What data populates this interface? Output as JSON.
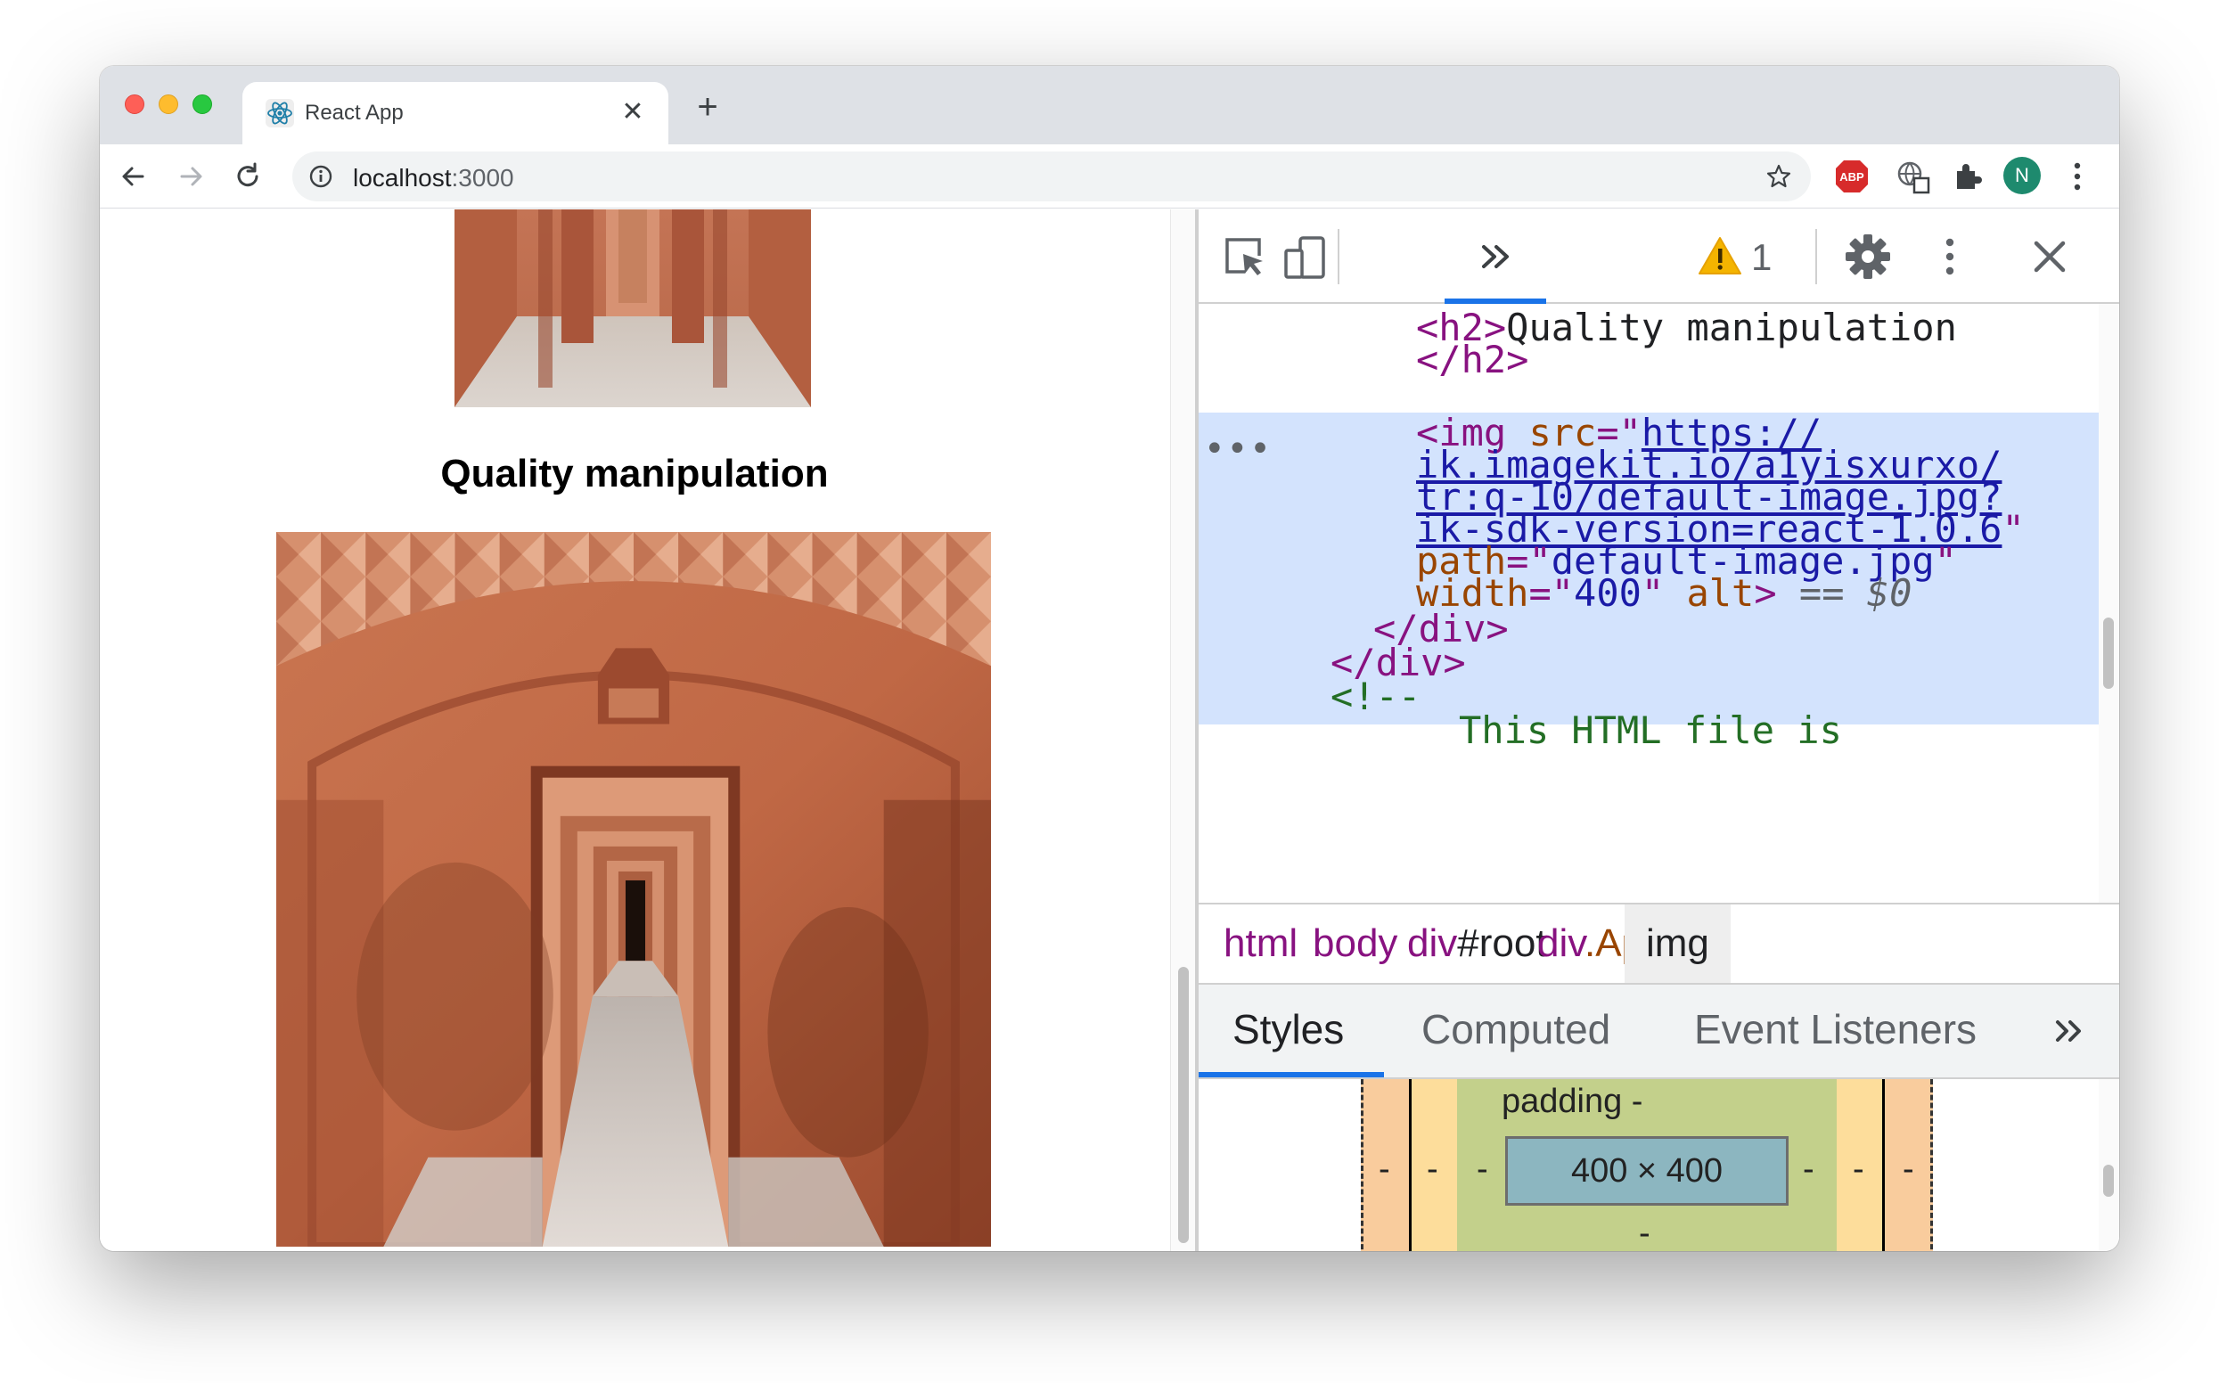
{
  "browser": {
    "tab_title": "React App",
    "tab_close": "✕",
    "new_tab": "+",
    "url_host": "localhost",
    "url_port": ":3000",
    "profile_initial": "N"
  },
  "page": {
    "heading": "Quality manipulation"
  },
  "devtools": {
    "warning_count": "1",
    "dom_ellipsis": "•••",
    "dom_lines": {
      "h2_open": "<h2>",
      "h2_text": "Quality manipulation",
      "h2_close": "</h2>",
      "img_open": "<img",
      "src_attr": "src",
      "eq": "=",
      "quote": "\"",
      "src_line1": "https://",
      "src_line2": "ik.imagekit.io/a1yisxurxo/",
      "src_line3": "tr:q-10/default-image.jpg?",
      "src_line4": "ik-sdk-version=react-1.0.6",
      "path_attr": "path",
      "path_val": "default-image.jpg",
      "width_attr": "width",
      "width_val": "400",
      "alt_attr": "alt",
      "gt": ">",
      "eq_dollar": " == ",
      "dollar0": "$0",
      "div_close1": "</div>",
      "div_close2": "</div>",
      "comment_open": "<!--",
      "comment_partial": "This HTML file is"
    },
    "breadcrumbs": [
      {
        "label": "html"
      },
      {
        "label": "body"
      },
      {
        "label_tag": "div",
        "label_id": "#root"
      },
      {
        "label_tag": "div",
        "label_cls": ".App"
      },
      {
        "label": "img"
      }
    ],
    "subtabs": [
      "Styles",
      "Computed",
      "Event Listeners"
    ],
    "box_model": {
      "padding_label": "padding -",
      "content_size": "400 × 400",
      "dash": "-"
    }
  },
  "colors": {
    "devtools_selection": "#d3e3fd",
    "tag": "#881280",
    "attr_name": "#994500",
    "attr_value": "#1a1aa6",
    "accent": "#1a73e8"
  },
  "icons": [
    "react-favicon",
    "back-icon",
    "forward-icon",
    "reload-icon",
    "info-icon",
    "star-icon",
    "adblock-icon",
    "translate-icon",
    "extensions-icon",
    "kebab-menu-icon",
    "inspect-icon",
    "device-toggle-icon",
    "more-tabs-icon",
    "warning-icon",
    "gear-icon",
    "close-icon"
  ]
}
